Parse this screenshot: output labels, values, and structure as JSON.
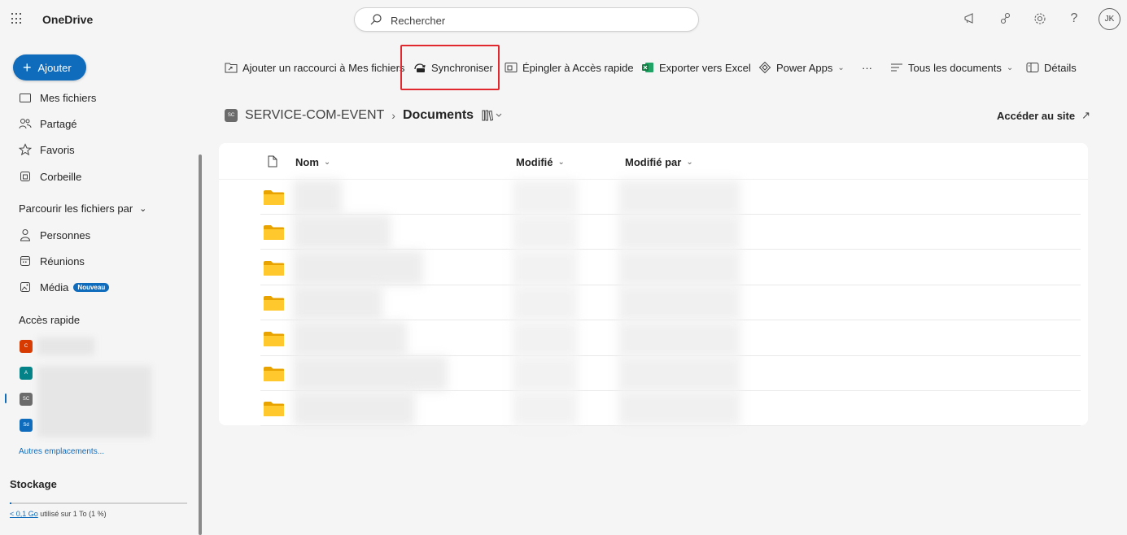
{
  "header": {
    "app_name": "OneDrive",
    "search_placeholder": "Rechercher",
    "user_initials": "JK"
  },
  "left_nav": {
    "add_label": "Ajouter",
    "items": [
      {
        "label": "Mes fichiers",
        "icon": "folder-icon"
      },
      {
        "label": "Partagé",
        "icon": "people-icon"
      },
      {
        "label": "Favoris",
        "icon": "star-icon"
      },
      {
        "label": "Corbeille",
        "icon": "recycle-bin-icon"
      }
    ],
    "browse_heading": "Parcourir les fichiers par",
    "browse_items": [
      {
        "label": "Personnes",
        "icon": "person-icon"
      },
      {
        "label": "Réunions",
        "icon": "calendar-icon"
      },
      {
        "label": "Média",
        "icon": "image-icon",
        "badge": "Nouveau"
      }
    ],
    "quick_access_heading": "Accès rapide",
    "quick_access_tiles": [
      {
        "initials": "C",
        "color": "#d83b01"
      },
      {
        "initials": "A",
        "color": "#038387"
      },
      {
        "initials": "SC",
        "color": "#6b6b6b"
      },
      {
        "initials": "Sd",
        "color": "#0f6cbd"
      }
    ],
    "other_locations": "Autres emplacements...",
    "storage_heading": "Stockage",
    "storage_used_link": "< 0,1 Go",
    "storage_used_rest": " utilisé sur 1 To (1 %)",
    "storage_percent": 1
  },
  "command_bar": {
    "add_shortcut": "Ajouter un raccourci à Mes fichiers",
    "sync": "Synchroniser",
    "pin": "Épingler à Accès rapide",
    "export_excel": "Exporter vers Excel",
    "power_apps": "Power Apps",
    "more": "···",
    "view": "Tous les documents",
    "details": "Détails"
  },
  "breadcrumb": {
    "site_icon": "SC",
    "site": "SERVICE-COM-EVENT",
    "library": "Documents",
    "goto_site": "Accéder au site"
  },
  "file_list": {
    "columns": [
      "Nom",
      "Modifié",
      "Modifié par"
    ],
    "rows": [
      {
        "type": "folder"
      },
      {
        "type": "folder"
      },
      {
        "type": "folder"
      },
      {
        "type": "folder"
      },
      {
        "type": "folder"
      },
      {
        "type": "folder"
      },
      {
        "type": "folder"
      }
    ]
  }
}
